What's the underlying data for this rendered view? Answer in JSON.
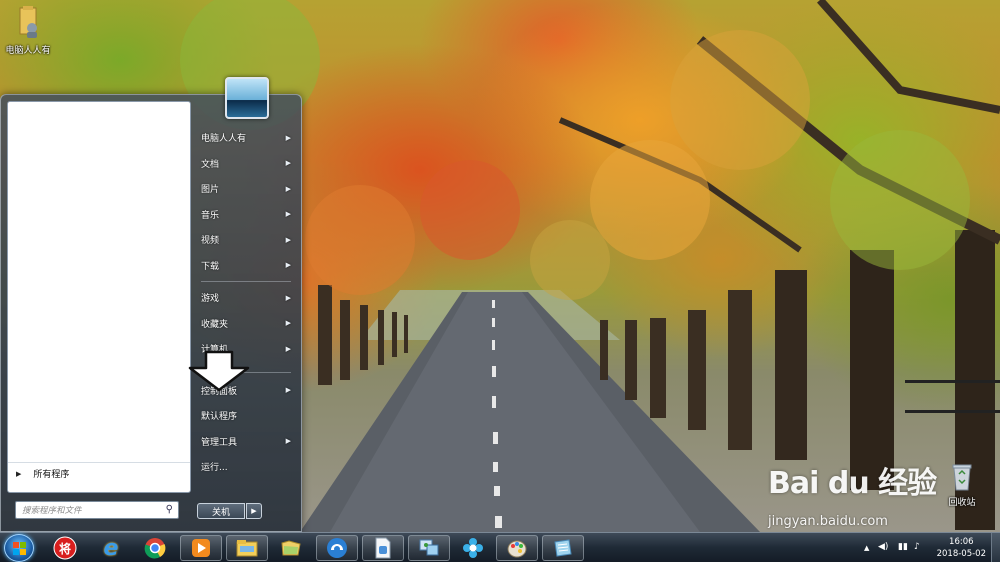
{
  "desktop": {
    "icons": [
      {
        "label": "电脑人人有",
        "icon": "user-folder-icon"
      },
      {
        "label": "回收站",
        "icon": "recycle-bin-icon"
      }
    ]
  },
  "start_menu": {
    "left_pane": {
      "all_programs_label": "所有程序",
      "search_placeholder": "搜索程序和文件"
    },
    "right_items": [
      {
        "label": "电脑人人有",
        "has_submenu": true
      },
      {
        "label": "文档",
        "has_submenu": true
      },
      {
        "label": "图片",
        "has_submenu": true
      },
      {
        "label": "音乐",
        "has_submenu": true
      },
      {
        "label": "视频",
        "has_submenu": true
      },
      {
        "label": "下载",
        "has_submenu": true
      },
      {
        "label": "游戏",
        "has_submenu": true
      },
      {
        "label": "收藏夹",
        "has_submenu": true
      },
      {
        "label": "计算机",
        "has_submenu": true
      },
      {
        "label": "控制面板",
        "has_submenu": true
      },
      {
        "label": "默认程序",
        "has_submenu": false
      },
      {
        "label": "管理工具",
        "has_submenu": true
      },
      {
        "label": "运行...",
        "has_submenu": false
      }
    ],
    "shutdown_label": "关机"
  },
  "taskbar": {
    "pinned": [
      {
        "name": "jiang-app-icon",
        "glyph": "将"
      },
      {
        "name": "internet-explorer-icon",
        "glyph": "e"
      },
      {
        "name": "chrome-icon",
        "glyph": ""
      },
      {
        "name": "media-player-icon",
        "glyph": ""
      },
      {
        "name": "file-explorer-icon",
        "glyph": ""
      },
      {
        "name": "folder-icon",
        "glyph": ""
      },
      {
        "name": "browser-icon",
        "glyph": ""
      },
      {
        "name": "document-icon",
        "glyph": ""
      },
      {
        "name": "network-icon",
        "glyph": ""
      },
      {
        "name": "flower-app-icon",
        "glyph": ""
      },
      {
        "name": "paint-icon",
        "glyph": ""
      },
      {
        "name": "notebook-icon",
        "glyph": ""
      }
    ],
    "tray": {
      "time": "16:06",
      "date": "2018-05-02"
    }
  },
  "watermark": {
    "logo_text": "Bai du 经验",
    "url": "jingyan.baidu.com"
  },
  "colors": {
    "taskbar": "#1f2a36",
    "menu_glass": "#46505c",
    "accent": "#3a86d0"
  }
}
